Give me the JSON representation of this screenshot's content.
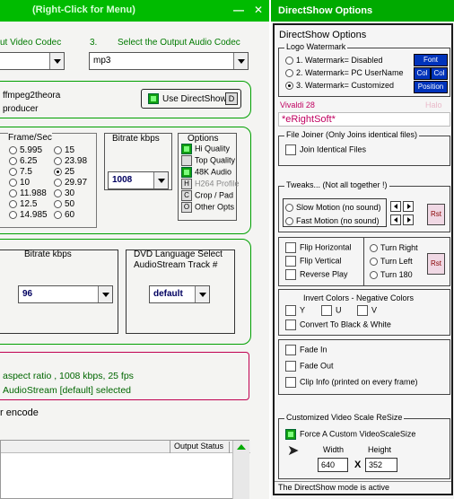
{
  "main": {
    "title": "(Right-Click for Menu)",
    "header_video_codec": "ut Video Codec",
    "header_num": "3.",
    "header_audio_codec": "Select the Output Audio Codec",
    "video_codec_value": "",
    "audio_codec_value": "mp3",
    "info_line1": "ffmpeg2theora",
    "info_line2": "producer",
    "use_directshow": "Use DirectShow",
    "directshow_key": "D",
    "framesec_label": "Frame/Sec",
    "fps_col1": [
      "5.995",
      "6.25",
      "7.5",
      "10",
      "11.988",
      "12.5",
      "14.985"
    ],
    "fps_col2": [
      "15",
      "23.98",
      "25",
      "29.97",
      "30",
      "50",
      "60"
    ],
    "fps_selected": "25",
    "bitrate_label": "Bitrate  kbps",
    "bitrate_value": "1008",
    "options_label": "Options",
    "options": [
      {
        "key": "",
        "label": "Hi Quality",
        "checked": true
      },
      {
        "key": "",
        "label": "Top Quality",
        "checked": false
      },
      {
        "key": "",
        "label": "48K Audio",
        "checked": true
      },
      {
        "key": "H",
        "label": "H264 Profile",
        "checked": false
      },
      {
        "key": "C",
        "label": "Crop / Pad",
        "checked": false
      },
      {
        "key": "O",
        "label": "Other Opts",
        "checked": false
      }
    ],
    "audio_bitrate_label": "Bitrate  kbps",
    "audio_bitrate_value": "96",
    "dvd_label_line1": "DVD Language Select",
    "dvd_label_line2": "AudioStream  Track #",
    "dvd_value": "default",
    "summary_line1": "aspect ratio ,  1008 kbps,  25 fps",
    "summary_line2": "AudioStream [default] selected",
    "encode_text": "r encode",
    "output_status_header": "Output Status"
  },
  "ds": {
    "title": "DirectShow Options",
    "header": "DirectShow Options",
    "logo_group": "Logo Watermark",
    "watermark_options": [
      "1. Watermark= Disabled",
      "2. Watermark= PC UserName",
      "3. Watermark= Customized"
    ],
    "watermark_selected": 2,
    "btn_font": "Font",
    "btn_col1": "Col",
    "btn_col2": "Col",
    "btn_position": "Position",
    "vivaldi_text": "Vivaldi 28",
    "halo_text": "Halo",
    "watermark_text": "*eRightSoft*",
    "joiner_group": "File Joiner (Only Joins identical files)",
    "join_identical": "Join Identical Files",
    "tweaks_group": "Tweaks... (Not all together !)",
    "slow_motion": "Slow Motion (no sound)",
    "fast_motion": "Fast Motion (no sound)",
    "rst": "Rst",
    "flip_horizontal": "Flip Horizontal",
    "flip_vertical": "Flip Vertical",
    "reverse_play": "Reverse Play",
    "turn_right": "Turn Right",
    "turn_left": "Turn Left",
    "turn_180": "Turn 180",
    "invert_title": "Invert Colors - Negative Colors",
    "invert_y": "Y",
    "invert_u": "U",
    "invert_v": "V",
    "convert_bw": "Convert To Black & White",
    "fade_in": "Fade In",
    "fade_out": "Fade Out",
    "clip_info": "Clip Info (printed on every frame)",
    "scale_group": "Customized Video Scale ReSize",
    "force_scale": "Force A Custom VideoScaleSize",
    "width_label": "Width",
    "height_label": "Height",
    "width_value": "640",
    "x_label": "X",
    "height_value": "352",
    "status": "The DirectShow mode is active"
  }
}
